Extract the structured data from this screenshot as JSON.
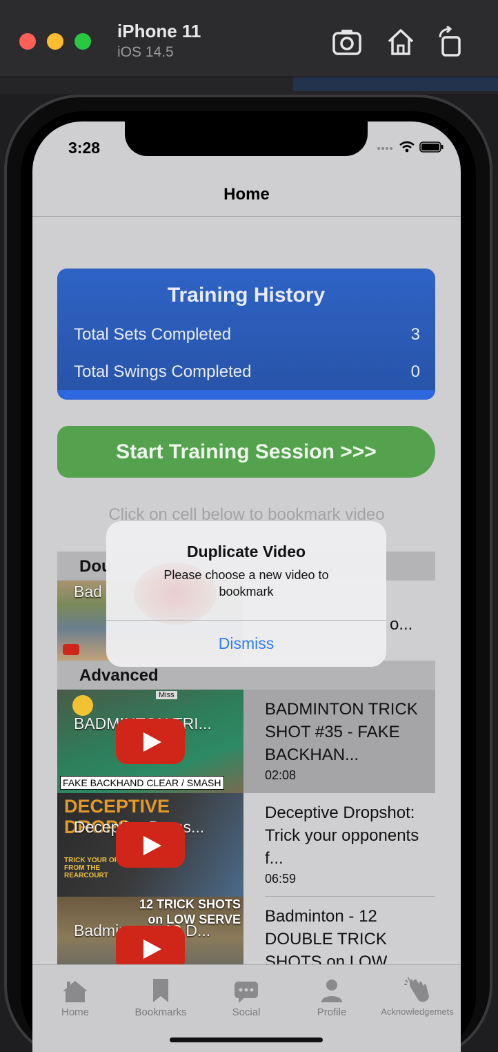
{
  "simulator": {
    "device": "iPhone 11",
    "os": "iOS 14.5"
  },
  "status_bar": {
    "time": "3:28"
  },
  "nav": {
    "title": "Home"
  },
  "training_history": {
    "title": "Training History",
    "stats": [
      {
        "label": "Total Sets Completed",
        "value": "3"
      },
      {
        "label": "Total Swings Completed",
        "value": "0"
      }
    ]
  },
  "start_button": {
    "label": "Start Training Session >>>"
  },
  "hint": "Click on cell below to bookmark video",
  "sections": [
    {
      "header": "Dou",
      "partial": true
    },
    {
      "header": "Advanced"
    }
  ],
  "partial_row": {
    "thumb_title": "Bad",
    "title_tail": "o..."
  },
  "videos": [
    {
      "thumb_title": "BADMINTON TRI...",
      "thumb_overlay_top": "Miss",
      "thumb_caption": "FAKE BACKHAND CLEAR / SMASH",
      "title": "BADMINTON TRICK SHOT #35 - FAKE BACKHAN...",
      "duration": "02:08",
      "selected": true
    },
    {
      "thumb_title": "Deceptive Drops...",
      "thumb_overlay_big": "DECEPTIVE DROPS",
      "thumb_overlay_small": "TRICK YOUR OPP FROM THE REARCOURT",
      "title": "Deceptive Dropshot: Trick your opponents f...",
      "duration": "06:59",
      "selected": false
    },
    {
      "thumb_title": "Badminton - 12 D...",
      "thumb_overlay_big": "12 TRICK SHOTS on LOW SERVE",
      "title": "Badminton - 12 DOUBLE TRICK SHOTS on LOW",
      "duration": "",
      "selected": false
    }
  ],
  "alert": {
    "title": "Duplicate Video",
    "message": "Please choose a new video to bookmark",
    "button": "Dismiss"
  },
  "tabs": [
    {
      "label": "Home",
      "icon": "house-icon"
    },
    {
      "label": "Bookmarks",
      "icon": "bookmark-icon"
    },
    {
      "label": "Social",
      "icon": "chat-bubble-icon"
    },
    {
      "label": "Profile",
      "icon": "person-icon"
    },
    {
      "label": "Acknowledgemets",
      "icon": "clapping-hands-icon"
    }
  ],
  "colors": {
    "card_blue": "#2b5cb8",
    "start_green": "#55a24e",
    "alert_link": "#2f7cf6",
    "youtube_red": "#d02619"
  }
}
